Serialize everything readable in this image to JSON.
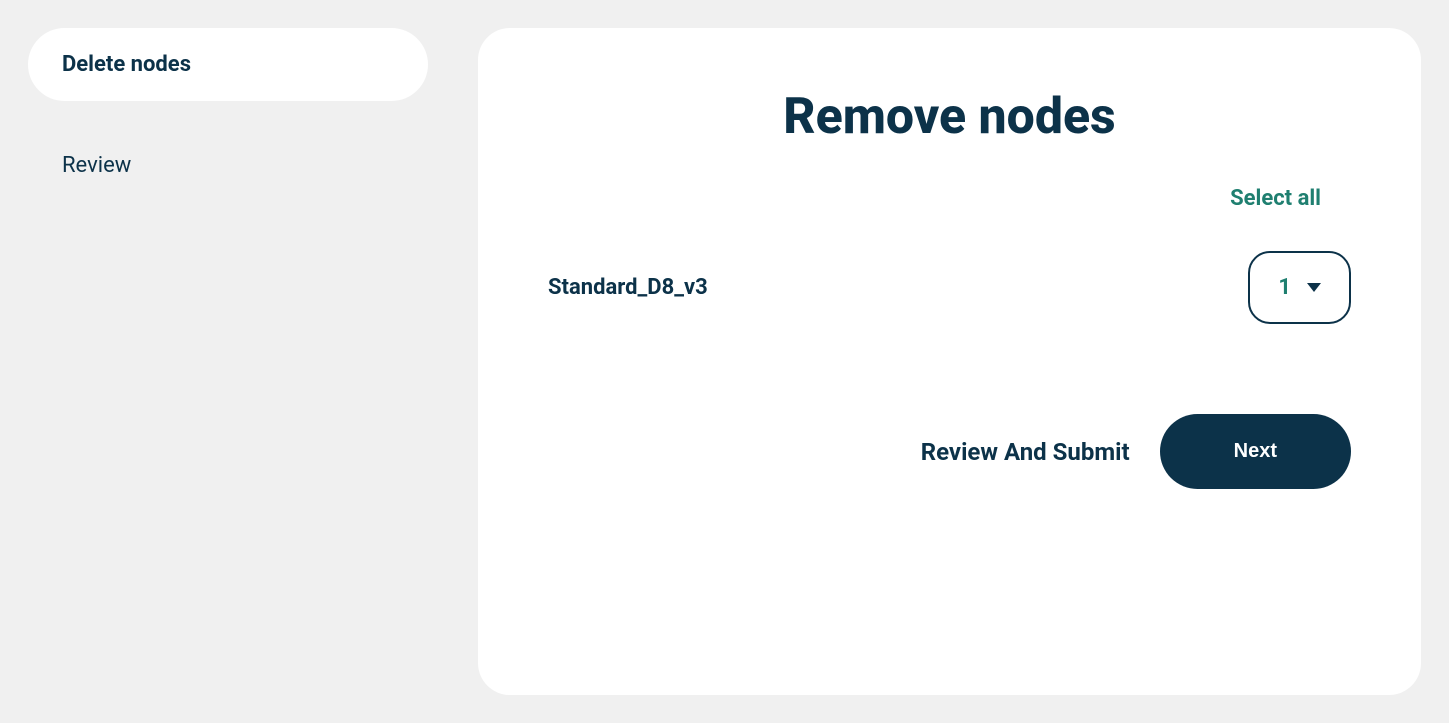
{
  "sidebar": {
    "items": [
      {
        "label": "Delete nodes",
        "active": true
      },
      {
        "label": "Review",
        "active": false
      }
    ]
  },
  "main": {
    "title": "Remove nodes",
    "select_all_label": "Select all",
    "nodes": [
      {
        "name": "Standard_D8_v3",
        "quantity": "1"
      }
    ],
    "review_submit_label": "Review And Submit",
    "next_button_label": "Next"
  }
}
